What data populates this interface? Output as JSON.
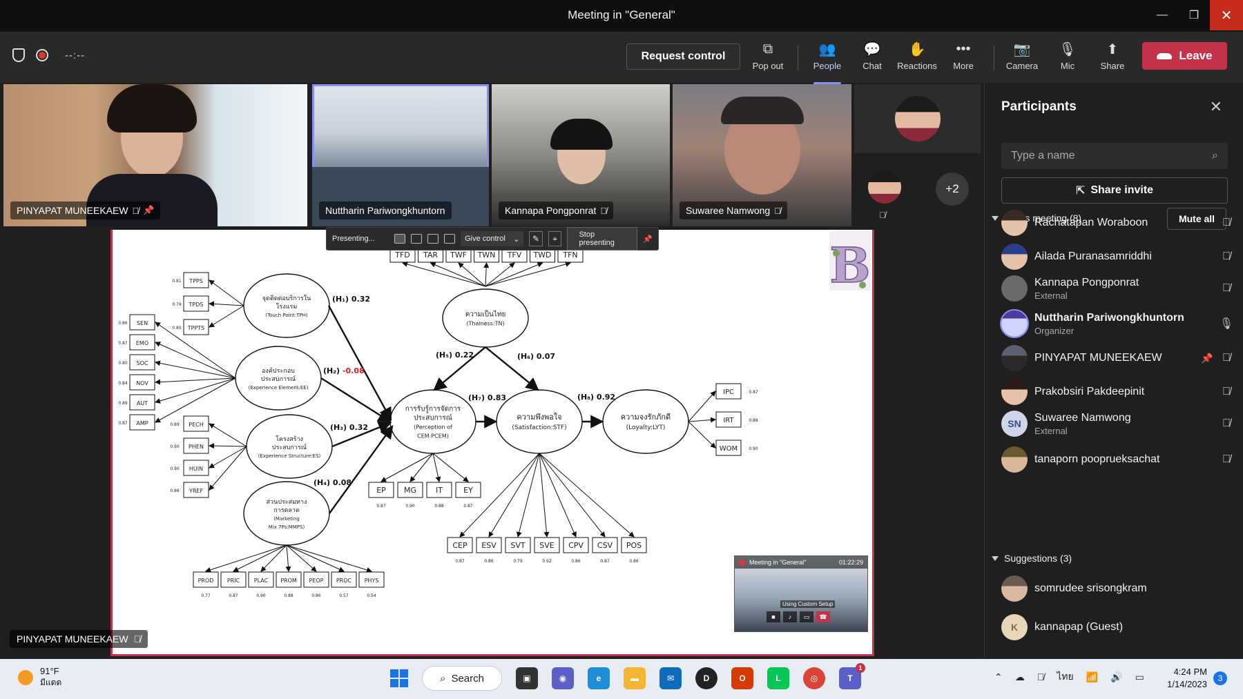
{
  "window": {
    "title": "Meeting in \"General\"",
    "min": "—",
    "restore": "❐",
    "close": "✕"
  },
  "toolbar": {
    "timer": "--:--",
    "request_control": "Request control",
    "buttons": [
      {
        "label": "Pop out",
        "icon": "pop-out-icon",
        "glyph": "⧉"
      },
      {
        "label": "People",
        "icon": "people-icon",
        "glyph": "👥"
      },
      {
        "label": "Chat",
        "icon": "chat-icon",
        "glyph": "💬"
      },
      {
        "label": "Reactions",
        "icon": "reactions-icon",
        "glyph": "✋"
      },
      {
        "label": "More",
        "icon": "more-icon",
        "glyph": "•••"
      },
      {
        "label": "Camera",
        "icon": "camera-off-icon",
        "glyph": "📷"
      },
      {
        "label": "Mic",
        "icon": "mic-off-icon",
        "glyph": "🎙"
      },
      {
        "label": "Share",
        "icon": "share-icon",
        "glyph": "⬆"
      }
    ],
    "leave": "Leave"
  },
  "videos": [
    {
      "name": "PINYAPAT MUNEEKAEW"
    },
    {
      "name": "Nuttharin Pariwongkhuntorn"
    },
    {
      "name": "Kannapa Pongponrat"
    },
    {
      "name": "Suwaree Namwong"
    }
  ],
  "overflow": {
    "more": "+2"
  },
  "presenting": {
    "status": "Presenting...",
    "give_control": "Give control",
    "stop": "Stop presenting"
  },
  "self_view_name": "PINYAPAT MUNEEKAEW",
  "pip": {
    "title": "Meeting in \"General\"",
    "time": "01:22:29",
    "caption": "Using Custom Setup"
  },
  "slide": {
    "top_boxes": [
      "TFD",
      "TAR",
      "TWF",
      "TWN",
      "TFV",
      "TWD",
      "TFN"
    ],
    "tn": [
      "ความเป็นไทย",
      "(Thainess:TN)"
    ],
    "tph": [
      "จุดติดต่อบริการใน",
      "โรงแรม",
      "(Touch Point:TPH)"
    ],
    "ee": [
      "องค์ประกอบ",
      "ประสบการณ์",
      "(Experience Element:EE)"
    ],
    "es": [
      "โครงสร้าง",
      "ประสบการณ์",
      "(Experience Structure:ES)"
    ],
    "mmps": [
      "ส่วนประสมทาง",
      "การตลาด",
      "(Marketing",
      "Mix 7Ps:MMPS)"
    ],
    "pcem": [
      "การรับรู้การจัดการ",
      "ประสบการณ์",
      "(Perception of",
      "CEM:PCEM)"
    ],
    "stf": [
      "ความพึงพอใจ",
      "(Satisfaction:STF)"
    ],
    "lyt": [
      "ความจงรักภักดี",
      "(Loyalty:LYT)"
    ],
    "tph_items": [
      {
        "k": "TPPS",
        "v": "0.81"
      },
      {
        "k": "TPDS",
        "v": "0.79"
      },
      {
        "k": "TPPTS",
        "v": "0.85"
      }
    ],
    "ee_items": [
      {
        "k": "SEN",
        "v": "0.86"
      },
      {
        "k": "EMO",
        "v": "0.87"
      },
      {
        "k": "SOC",
        "v": "0.80"
      },
      {
        "k": "NOV",
        "v": "0.84"
      },
      {
        "k": "AUT",
        "v": "0.89"
      },
      {
        "k": "AMP",
        "v": "0.87"
      }
    ],
    "es_items": [
      {
        "k": "PECH",
        "v": "0.89"
      },
      {
        "k": "PHEN",
        "v": "0.90"
      },
      {
        "k": "HUIN",
        "v": "0.90"
      },
      {
        "k": "YREF",
        "v": "0.86"
      }
    ],
    "mmps_items": [
      {
        "k": "PROD",
        "v": "0.77"
      },
      {
        "k": "PRIC",
        "v": "0.87"
      },
      {
        "k": "PLAC",
        "v": "0.90"
      },
      {
        "k": "PROM",
        "v": "0.88"
      },
      {
        "k": "PEOP",
        "v": "0.86"
      },
      {
        "k": "PROC",
        "v": "0.57"
      },
      {
        "k": "PHYS",
        "v": "0.54"
      }
    ],
    "pcem_items": [
      {
        "k": "EP",
        "v": "0.87"
      },
      {
        "k": "MG",
        "v": "0.90"
      },
      {
        "k": "IT",
        "v": "0.88"
      },
      {
        "k": "EY",
        "v": "0.87"
      }
    ],
    "stf_items": [
      {
        "k": "CEP",
        "v": "0.87"
      },
      {
        "k": "ESV",
        "v": "0.86"
      },
      {
        "k": "SVT",
        "v": "0.79"
      },
      {
        "k": "SVE",
        "v": "0.92"
      },
      {
        "k": "CPV",
        "v": "0.86"
      },
      {
        "k": "CSV",
        "v": "0.87"
      },
      {
        "k": "POS",
        "v": "0.86"
      }
    ],
    "lyt_items": [
      {
        "k": "IPC",
        "v": "0.87"
      },
      {
        "k": "IRT",
        "v": "0.88"
      },
      {
        "k": "WOM",
        "v": "0.90"
      }
    ],
    "paths": {
      "h1": {
        "label": "(H₁)",
        "value": "0.32"
      },
      "h2": {
        "label": "(H₂)",
        "value": "-0.08"
      },
      "h3": {
        "label": "(H₃)",
        "value": "0.32"
      },
      "h4": {
        "label": "(H₄)",
        "value": "0.08"
      },
      "h5": {
        "label": "(H₅)",
        "value": "0.22"
      },
      "h6": {
        "label": "(H₆)",
        "value": "0.07"
      },
      "h7": {
        "label": "(H₇)",
        "value": "0.83"
      },
      "h8": {
        "label": "(H₈)",
        "value": "0.92"
      }
    },
    "logo_letter": "B"
  },
  "panel": {
    "title": "Participants",
    "search_placeholder": "Type a name",
    "share_invite": "Share invite",
    "in_meeting": "In this meeting (8)",
    "mute_all": "Mute all",
    "participants": [
      {
        "name": "Rachatapan Woraboon",
        "sub": ""
      },
      {
        "name": "Ailada Puranasamriddhi",
        "sub": ""
      },
      {
        "name": "Kannapa Pongponrat",
        "sub": "External"
      },
      {
        "name": "Nuttharin Pariwongkhuntorn",
        "sub": "Organizer"
      },
      {
        "name": "PINYAPAT MUNEEKAEW",
        "sub": ""
      },
      {
        "name": "Prakobsiri Pakdeepinit",
        "sub": ""
      },
      {
        "name": "Suwaree Namwong",
        "sub": "External",
        "initials": "SN"
      },
      {
        "name": "tanaporn pooprueksachat",
        "sub": ""
      }
    ],
    "suggestions": "Suggestions (3)",
    "suggested": [
      {
        "name": "somrudee srisongkram"
      },
      {
        "name": "kannapap (Guest)",
        "initials": "K"
      }
    ]
  },
  "taskbar": {
    "temp": "91°F",
    "condition": "มีแดด",
    "search": "Search",
    "lang": "ไทย",
    "time": "4:24 PM",
    "date": "1/14/2023",
    "notifications": "3",
    "teams_badge": "1"
  },
  "colors": {
    "accent": "#8b8cf5",
    "leave": "#c4314b",
    "panel": "#1f1f1f"
  }
}
